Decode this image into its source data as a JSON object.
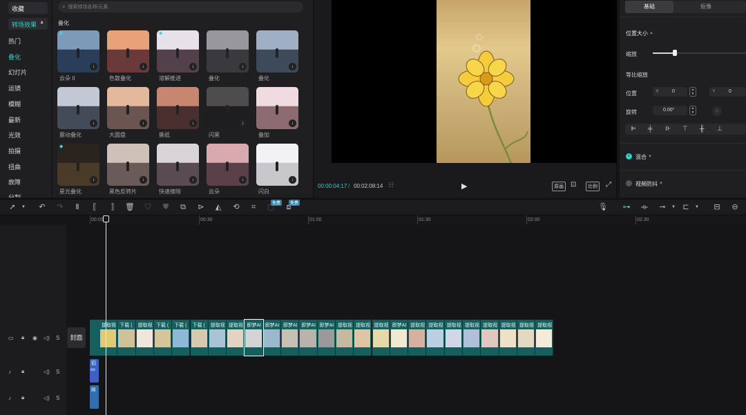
{
  "left_nav": {
    "items": [
      {
        "label": "收藏",
        "type": "button"
      },
      {
        "label": "转场效果",
        "type": "button",
        "active": true
      },
      {
        "label": "热门"
      },
      {
        "label": "叠化",
        "selected": true
      },
      {
        "label": "幻灯片"
      },
      {
        "label": "运镜"
      },
      {
        "label": "模糊"
      },
      {
        "label": "最新"
      },
      {
        "label": "光效"
      },
      {
        "label": "拍摄"
      },
      {
        "label": "扭曲"
      },
      {
        "label": "故障"
      },
      {
        "label": "分割"
      }
    ]
  },
  "library": {
    "search_placeholder": "搜索转场名称/元素",
    "category": "叠化",
    "tiles": [
      {
        "label": "云朵 II",
        "badge": true
      },
      {
        "label": "色散叠化"
      },
      {
        "label": "溶解推进",
        "badge": true
      },
      {
        "label": "叠化"
      },
      {
        "label": "叠化"
      },
      {
        "label": "震动叠化"
      },
      {
        "label": "大圆盘"
      },
      {
        "label": "撕纸"
      },
      {
        "label": "闪黑"
      },
      {
        "label": "叠加"
      },
      {
        "label": "星光叠化",
        "badge": true
      },
      {
        "label": "黑色反转片"
      },
      {
        "label": "快速擦除"
      },
      {
        "label": "云朵"
      },
      {
        "label": "闪白"
      }
    ]
  },
  "preview": {
    "current_time": "00:00:04:17",
    "total_time": "00:02:08:14",
    "controls": [
      "原画",
      "比例"
    ]
  },
  "properties": {
    "tabs": [
      "基础",
      "抠像"
    ],
    "section_title": "位置大小",
    "scale_label": "缩放",
    "uniform_scale_label": "等比缩放",
    "position_label": "位置",
    "x_label": "X",
    "x_value": "0",
    "y_label": "Y",
    "y_value": "0",
    "rotate_label": "旋转",
    "rotate_value": "0.00°",
    "blend_label": "混合",
    "stabilize_label": "视频防抖",
    "scale_level": 0.24
  },
  "toolbar": {
    "badges": [
      "免费",
      "免费"
    ]
  },
  "timeline": {
    "ruler_ticks": [
      "00:00",
      "00:30",
      "01:00",
      "01:30",
      "02:00",
      "02:30"
    ],
    "cover_label": "封面",
    "clip_labels": [
      "提取视",
      "下载 (",
      "提取视",
      "下载 (",
      "下载 (",
      "下载 (",
      "提取视",
      "提取视",
      "即梦AI",
      "即梦AI",
      "即梦AI",
      "即梦AI",
      "即梦AI",
      "提取视",
      "提取视",
      "提取视",
      "即梦AI",
      "提取视",
      "提取视",
      "提取视",
      "提取视",
      "提取视",
      "提取视",
      "提取视",
      "提取视"
    ],
    "audio_clip_label": "旧"
  },
  "colors": {
    "accent": "#33cfc9",
    "clip": "#15605f"
  }
}
